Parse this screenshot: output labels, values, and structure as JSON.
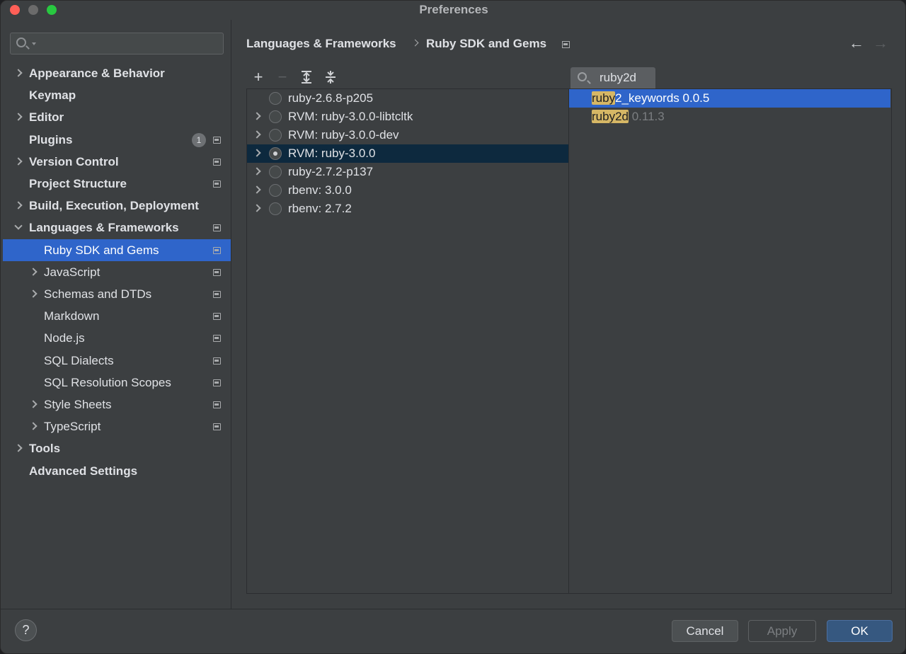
{
  "window": {
    "title": "Preferences"
  },
  "sidebar": {
    "search_placeholder": "",
    "items": [
      {
        "label": "Appearance & Behavior",
        "bold": true,
        "expandable": true
      },
      {
        "label": "Keymap",
        "bold": true
      },
      {
        "label": "Editor",
        "bold": true,
        "expandable": true
      },
      {
        "label": "Plugins",
        "bold": true,
        "badge": "1",
        "settings": true
      },
      {
        "label": "Version Control",
        "bold": true,
        "expandable": true,
        "settings": true
      },
      {
        "label": "Project Structure",
        "bold": true,
        "settings": true
      },
      {
        "label": "Build, Execution, Deployment",
        "bold": true,
        "expandable": true
      },
      {
        "label": "Languages & Frameworks",
        "bold": true,
        "expanded": true,
        "settings": true
      },
      {
        "label": "Ruby SDK and Gems",
        "selected": true,
        "settings": true
      },
      {
        "label": "JavaScript",
        "expandable": true,
        "settings": true
      },
      {
        "label": "Schemas and DTDs",
        "expandable": true,
        "settings": true
      },
      {
        "label": "Markdown",
        "settings": true
      },
      {
        "label": "Node.js",
        "settings": true
      },
      {
        "label": "SQL Dialects",
        "settings": true
      },
      {
        "label": "SQL Resolution Scopes",
        "settings": true
      },
      {
        "label": "Style Sheets",
        "expandable": true,
        "settings": true
      },
      {
        "label": "TypeScript",
        "expandable": true,
        "settings": true
      },
      {
        "label": "Tools",
        "bold": true,
        "expandable": true
      },
      {
        "label": "Advanced Settings",
        "bold": true
      }
    ]
  },
  "breadcrumb": {
    "parent": "Languages & Frameworks",
    "current": "Ruby SDK and Gems"
  },
  "nav": {
    "back": "←",
    "forward": "→"
  },
  "toolbar": {
    "add": "+",
    "remove": "−",
    "expand_all": "expand-all-icon",
    "collapse_all": "collapse-all-icon"
  },
  "sdks": [
    {
      "label": "ruby-2.6.8-p205",
      "expandable": false,
      "checked": false
    },
    {
      "label": "RVM: ruby-3.0.0-libtcltk",
      "expandable": true,
      "checked": false
    },
    {
      "label": "RVM: ruby-3.0.0-dev",
      "expandable": true,
      "checked": false
    },
    {
      "label": "RVM: ruby-3.0.0",
      "expandable": true,
      "checked": true,
      "selected": true
    },
    {
      "label": "ruby-2.7.2-p137",
      "expandable": true,
      "checked": false
    },
    {
      "label": "rbenv: 3.0.0",
      "expandable": true,
      "checked": false
    },
    {
      "label": "rbenv: 2.7.2",
      "expandable": true,
      "checked": false
    }
  ],
  "gem_search": {
    "query": "ruby2d"
  },
  "gems": [
    {
      "highlight": "ruby",
      "rest": "2_keywords",
      "version": "0.0.5",
      "selected": true
    },
    {
      "highlight": "ruby2d",
      "rest": "",
      "version": "0.11.3",
      "selected": false
    }
  ],
  "buttons": {
    "help": "?",
    "cancel": "Cancel",
    "apply": "Apply",
    "ok": "OK"
  },
  "colors": {
    "accent": "#2f65ca",
    "highlight": "#d6b765",
    "primary_button": "#365880"
  }
}
